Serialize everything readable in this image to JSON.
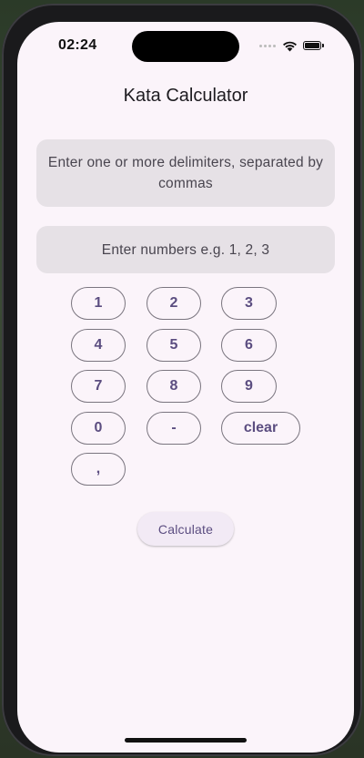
{
  "status_bar": {
    "time": "02:24"
  },
  "app": {
    "title": "Kata Calculator"
  },
  "inputs": {
    "delimiters_placeholder": "Enter one or more delimiters, separated by commas",
    "numbers_placeholder": "Enter numbers e.g. 1, 2, 3"
  },
  "keypad": {
    "keys": [
      "1",
      "2",
      "3",
      "4",
      "5",
      "6",
      "7",
      "8",
      "9",
      "0",
      "-",
      "clear",
      ","
    ]
  },
  "actions": {
    "calculate_label": "Calculate"
  },
  "colors": {
    "background": "#fbf4fa",
    "field_fill": "#e6e1e6",
    "accent": "#5b4d80"
  }
}
